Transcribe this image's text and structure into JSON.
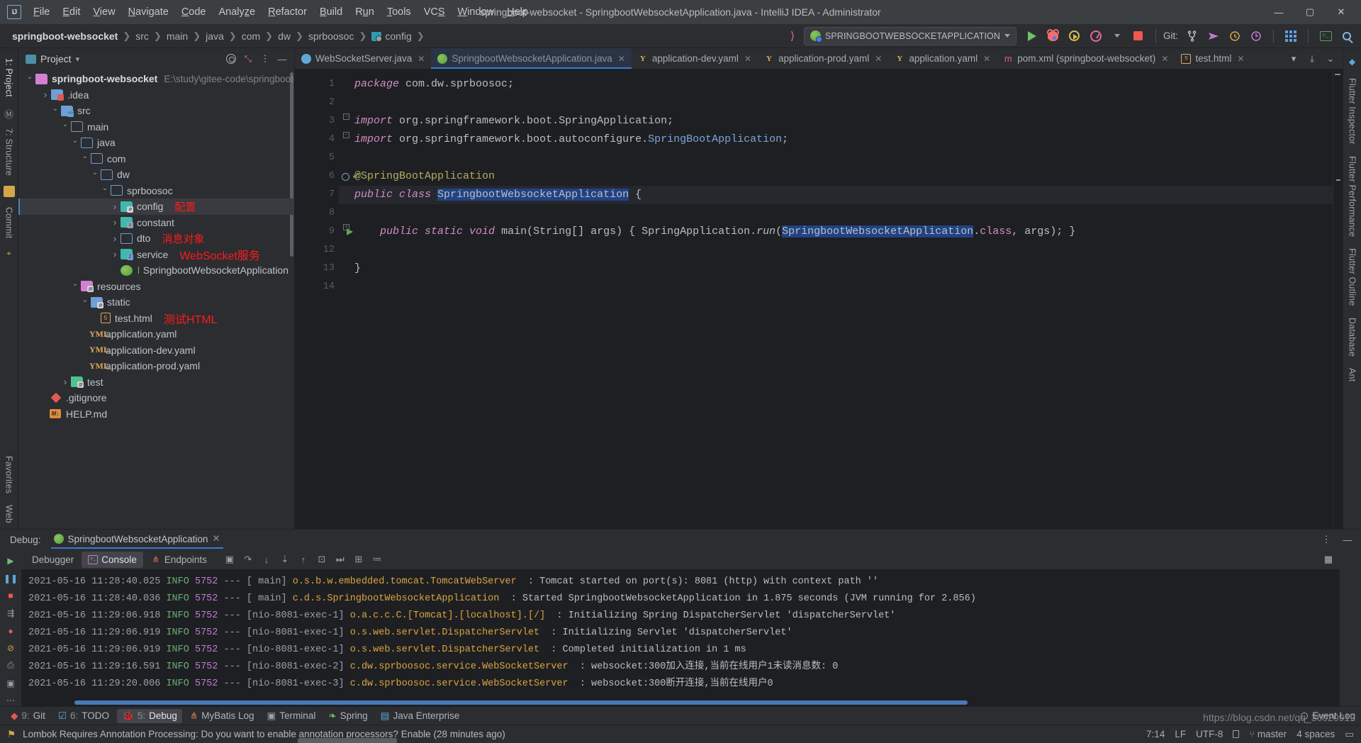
{
  "window": {
    "title": "springboot-websocket - SpringbootWebsocketApplication.java - IntelliJ IDEA - Administrator",
    "logo": "intellij-logo",
    "minimize": "–",
    "maximize": "▢",
    "close": "✕"
  },
  "menu": [
    "File",
    "Edit",
    "View",
    "Navigate",
    "Code",
    "Analyze",
    "Refactor",
    "Build",
    "Run",
    "Tools",
    "VCS",
    "Window",
    "Help"
  ],
  "breadcrumbs": [
    {
      "label": "springboot-websocket",
      "root": true
    },
    {
      "label": "src"
    },
    {
      "label": "main"
    },
    {
      "label": "java"
    },
    {
      "label": "com"
    },
    {
      "label": "dw"
    },
    {
      "label": "sprboosoc"
    },
    {
      "label": "config",
      "icon": "config-folder-icon"
    }
  ],
  "toolbar": {
    "run_config": "SPRINGBOOTWEBSOCKETAPPLICATION",
    "run_button": "run-icon",
    "debug_button": "debug-icon",
    "run_with_coverage": "coverage-icon",
    "profiler": "profiler-icon",
    "stop_button": "stop-icon",
    "git_label": "Git:",
    "update_project": "update-project-icon",
    "commit": "commit-icon",
    "history": "history-icon",
    "rollback": "rollback-icon",
    "layout": "layout-icon",
    "terminal": "terminal-icon",
    "search_everywhere": "search-icon",
    "chevron": "▾"
  },
  "left_strip": [
    {
      "label": "1: Project",
      "selected": true
    },
    {
      "label": "7: Structure",
      "selected": false
    },
    {
      "label": "Commit",
      "selected": false
    }
  ],
  "right_strip": [
    {
      "label": "Flutter Inspector"
    },
    {
      "label": "Flutter Performance"
    },
    {
      "label": "Flutter Outline"
    },
    {
      "label": "Database"
    },
    {
      "label": "Ant"
    }
  ],
  "bottom_left_strip": [
    "Favorites",
    "Web"
  ],
  "project_tool": {
    "title": "Project",
    "title_chevron": "▾",
    "actions": [
      "target-icon",
      "collapse-all-icon",
      "more-options-icon",
      "hide-icon"
    ]
  },
  "tree": [
    {
      "indent": 0,
      "arrow": "open",
      "icon": "project-folder-icon",
      "label": "springboot-websocket",
      "bold": true,
      "path": "E:\\study\\gitee-code\\springboot-websocket"
    },
    {
      "indent": 1,
      "arrow": "closed",
      "icon": "idea-folder-icon",
      "label": ".idea"
    },
    {
      "indent": 1,
      "arrow": "open",
      "icon": "source-folder-icon",
      "label": "src"
    },
    {
      "indent": 2,
      "arrow": "open",
      "icon": "folder-icon",
      "label": "main"
    },
    {
      "indent": 3,
      "arrow": "open",
      "icon": "folder-icon-blue",
      "label": "java"
    },
    {
      "indent": 4,
      "arrow": "open",
      "icon": "folder-icon-blue",
      "label": "com"
    },
    {
      "indent": 5,
      "arrow": "open",
      "icon": "folder-icon-blue",
      "label": "dw"
    },
    {
      "indent": 6,
      "arrow": "open",
      "icon": "folder-icon-blue",
      "label": "sprboosoc"
    },
    {
      "indent": 7,
      "arrow": "closed",
      "icon": "config-folder-icon",
      "label": "config",
      "annotation": "配置",
      "selected": true
    },
    {
      "indent": 7,
      "arrow": "closed",
      "icon": "constant-folder-icon",
      "label": "constant"
    },
    {
      "indent": 7,
      "arrow": "closed",
      "icon": "folder-icon-blue",
      "label": "dto",
      "annotation": "消息对象"
    },
    {
      "indent": 7,
      "arrow": "closed",
      "icon": "service-folder-icon",
      "label": "service",
      "annotation": "WebSocket服务",
      "annotation_big": true
    },
    {
      "indent": 7,
      "arrow": "none",
      "icon": "spring-class-icon",
      "label": "SpringbootWebsocketApplication"
    },
    {
      "indent": 3,
      "arrow": "open",
      "icon": "resources-folder-icon",
      "label": "resources"
    },
    {
      "indent": 4,
      "arrow": "open",
      "icon": "static-folder-icon",
      "label": "static"
    },
    {
      "indent": 5,
      "arrow": "none",
      "icon": "html-file-icon",
      "label": "test.html",
      "annotation": "测试HTML",
      "annotation_big": true
    },
    {
      "indent": 4,
      "arrow": "none",
      "icon": "yaml-file-icon",
      "label": "application.yaml"
    },
    {
      "indent": 4,
      "arrow": "none",
      "icon": "yaml-file-icon",
      "label": "application-dev.yaml"
    },
    {
      "indent": 4,
      "arrow": "none",
      "icon": "yaml-file-icon",
      "label": "application-prod.yaml"
    },
    {
      "indent": 2,
      "arrow": "closed",
      "icon": "test-folder-icon",
      "label": "test"
    },
    {
      "indent": 1,
      "arrow": "none",
      "icon": "gitignore-icon",
      "label": ".gitignore"
    },
    {
      "indent": 1,
      "arrow": "none",
      "icon": "markdown-icon",
      "label": "HELP.md"
    }
  ],
  "editor_tabs": [
    {
      "label": "WebSocketServer.java",
      "icon": "java-class-icon",
      "active": false
    },
    {
      "label": "SpringbootWebsocketApplication.java",
      "icon": "spring-class-icon",
      "active": true
    },
    {
      "label": "application-dev.yaml",
      "icon": "yaml-file-icon",
      "active": false
    },
    {
      "label": "application-prod.yaml",
      "icon": "yaml-file-icon",
      "active": false
    },
    {
      "label": "application.yaml",
      "icon": "yaml-file-icon",
      "active": false
    },
    {
      "label": "pom.xml (springboot-websocket)",
      "icon": "maven-icon",
      "active": false
    },
    {
      "label": "test.html",
      "icon": "html-file-icon",
      "active": false
    }
  ],
  "editor_tab_close": "✕",
  "code": {
    "lines": [
      {
        "num": 1,
        "html": "<span class=\"kw\">package</span> <span class=\"plain\">com.dw.sprboosoc;</span>"
      },
      {
        "num": 2,
        "html": ""
      },
      {
        "num": 3,
        "html": "<span class=\"kw\">import</span> <span class=\"plain\">org.springframework.boot.</span><span class=\"plain\">SpringApplication;</span>",
        "fold": true
      },
      {
        "num": 4,
        "html": "<span class=\"kw\">import</span> <span class=\"plain\">org.springframework.boot.autoconfigure.</span><span class=\"type\">SpringBootApplication</span><span class=\"plain\">;</span>",
        "fold": true
      },
      {
        "num": 5,
        "html": ""
      },
      {
        "num": 6,
        "html": "<span class=\"ann\">@SpringBootApplication</span>",
        "marks": [
          "bean",
          "check"
        ]
      },
      {
        "num": 7,
        "html": "<span class=\"kw\">public class</span> <span class=\"sel-text\">SpringbootWebsocketApplication</span> <span class=\"plain\">{</span>",
        "marks": [
          "spring",
          "run"
        ],
        "cursor": true
      },
      {
        "num": 8,
        "html": ""
      },
      {
        "num": 9,
        "html": "    <span class=\"kw\">public static</span> <span class=\"kw\">void</span> <span class=\"plain\">main(String[] args) {</span> <span class=\"plain\">SpringApplication.</span><span class=\"plain\" style=\"font-style:italic\">run</span><span class=\"plain\">(</span><span class=\"sel-text\">SpringbootWebsocketApplication</span><span class=\"plain\">.</span><span class=\"kw2\">class</span><span class=\"plain\">, args); }</span>",
        "marks": [
          "run"
        ],
        "fold": true
      },
      {
        "num": 12,
        "html": ""
      },
      {
        "num": 13,
        "html": "<span class=\"plain\">}</span>"
      },
      {
        "num": 14,
        "html": ""
      }
    ]
  },
  "debug": {
    "label": "Debug:",
    "session_tab": "SpringbootWebsocketApplication",
    "session_close": "✕",
    "tabs": [
      {
        "label": "Debugger",
        "active": false,
        "icon": "debugger-icon"
      },
      {
        "label": "Console",
        "active": true,
        "icon": "console-icon"
      },
      {
        "label": "Endpoints",
        "active": false,
        "icon": "endpoints-icon"
      }
    ],
    "tools": [
      "rerun-icon",
      "step-over-icon",
      "step-into-icon",
      "force-step-into-icon",
      "step-out-icon",
      "run-to-cursor-icon",
      "evaluate-icon",
      "settings-icon",
      "mute-breakpoints-icon"
    ],
    "side_tools": [
      "rerun-icon",
      "pause-icon",
      "stop-icon",
      "restore-layout-icon",
      "breakpoints-icon",
      "mute-icon",
      "print-icon",
      "camera-icon",
      "more-icon"
    ],
    "head_actions": [
      "more-options-icon",
      "hide-icon"
    ]
  },
  "console_lines": [
    {
      "date": "2021-05-16 11:28:40.025",
      "level": "INFO",
      "pid": "5752",
      "dash": "---",
      "thread": "[           main]",
      "logger": "o.s.b.w.embedded.tomcat.TomcatWebServer",
      "sep": ":",
      "message": "Tomcat started on port(s): 8081 (http) with context path ''"
    },
    {
      "date": "2021-05-16 11:28:40.036",
      "level": "INFO",
      "pid": "5752",
      "dash": "---",
      "thread": "[           main]",
      "logger": "c.d.s.SpringbootWebsocketApplication",
      "sep": ":",
      "message": "Started SpringbootWebsocketApplication in 1.875 seconds (JVM running for 2.856)"
    },
    {
      "date": "2021-05-16 11:29:06.918",
      "level": "INFO",
      "pid": "5752",
      "dash": "---",
      "thread": "[nio-8081-exec-1]",
      "logger": "o.a.c.c.C.[Tomcat].[localhost].[/]",
      "sep": ":",
      "message": "Initializing Spring DispatcherServlet 'dispatcherServlet'"
    },
    {
      "date": "2021-05-16 11:29:06.919",
      "level": "INFO",
      "pid": "5752",
      "dash": "---",
      "thread": "[nio-8081-exec-1]",
      "logger": "o.s.web.servlet.DispatcherServlet",
      "sep": ":",
      "message": "Initializing Servlet 'dispatcherServlet'"
    },
    {
      "date": "2021-05-16 11:29:06.919",
      "level": "INFO",
      "pid": "5752",
      "dash": "---",
      "thread": "[nio-8081-exec-1]",
      "logger": "o.s.web.servlet.DispatcherServlet",
      "sep": ":",
      "message": "Completed initialization in 1 ms"
    },
    {
      "date": "2021-05-16 11:29:16.591",
      "level": "INFO",
      "pid": "5752",
      "dash": "---",
      "thread": "[nio-8081-exec-2]",
      "logger": "c.dw.sprboosoc.service.WebSocketServer",
      "sep": ":",
      "message": "websocket:300加入连接,当前在线用户1未读消息数: 0"
    },
    {
      "date": "2021-05-16 11:29:20.006",
      "level": "INFO",
      "pid": "5752",
      "dash": "---",
      "thread": "[nio-8081-exec-3]",
      "logger": "c.dw.sprboosoc.service.WebSocketServer",
      "sep": ":",
      "message": "websocket:300断开连接,当前在线用户0"
    }
  ],
  "bottom_tabs": [
    {
      "num": "9:",
      "label": "Git",
      "icon": "git-icon",
      "active": false
    },
    {
      "num": "6:",
      "label": "TODO",
      "icon": "todo-icon",
      "active": false
    },
    {
      "num": "5:",
      "label": "Debug",
      "icon": "debug-icon",
      "active": true
    },
    {
      "num": "",
      "label": "MyBatis Log",
      "icon": "mybatis-icon",
      "active": false
    },
    {
      "num": "",
      "label": "Terminal",
      "icon": "terminal-icon",
      "active": false
    },
    {
      "num": "",
      "label": "Spring",
      "icon": "spring-icon",
      "active": false
    },
    {
      "num": "",
      "label": "Java Enterprise",
      "icon": "java-enterprise-icon",
      "active": false
    }
  ],
  "event_log": "Event Log",
  "statusbar": {
    "message": "Lombok Requires Annotation Processing: Do you want to enable annotation processors? Enable (28 minutes ago)",
    "caret": "7:14",
    "line_separator": "LF",
    "encoding": "UTF-8",
    "indent": "4 spaces",
    "branch": "master",
    "lock": "lock-icon",
    "memory": "memory-indicator"
  },
  "watermark": "https://blog.csdn.net/qq_36020919",
  "colors": {
    "accent_blue": "#3d7ad1",
    "annotation_red": "#ff1a1a",
    "selection": "#214283",
    "editor_bg": "#1e1f22",
    "panel_bg": "#2b2d30"
  }
}
